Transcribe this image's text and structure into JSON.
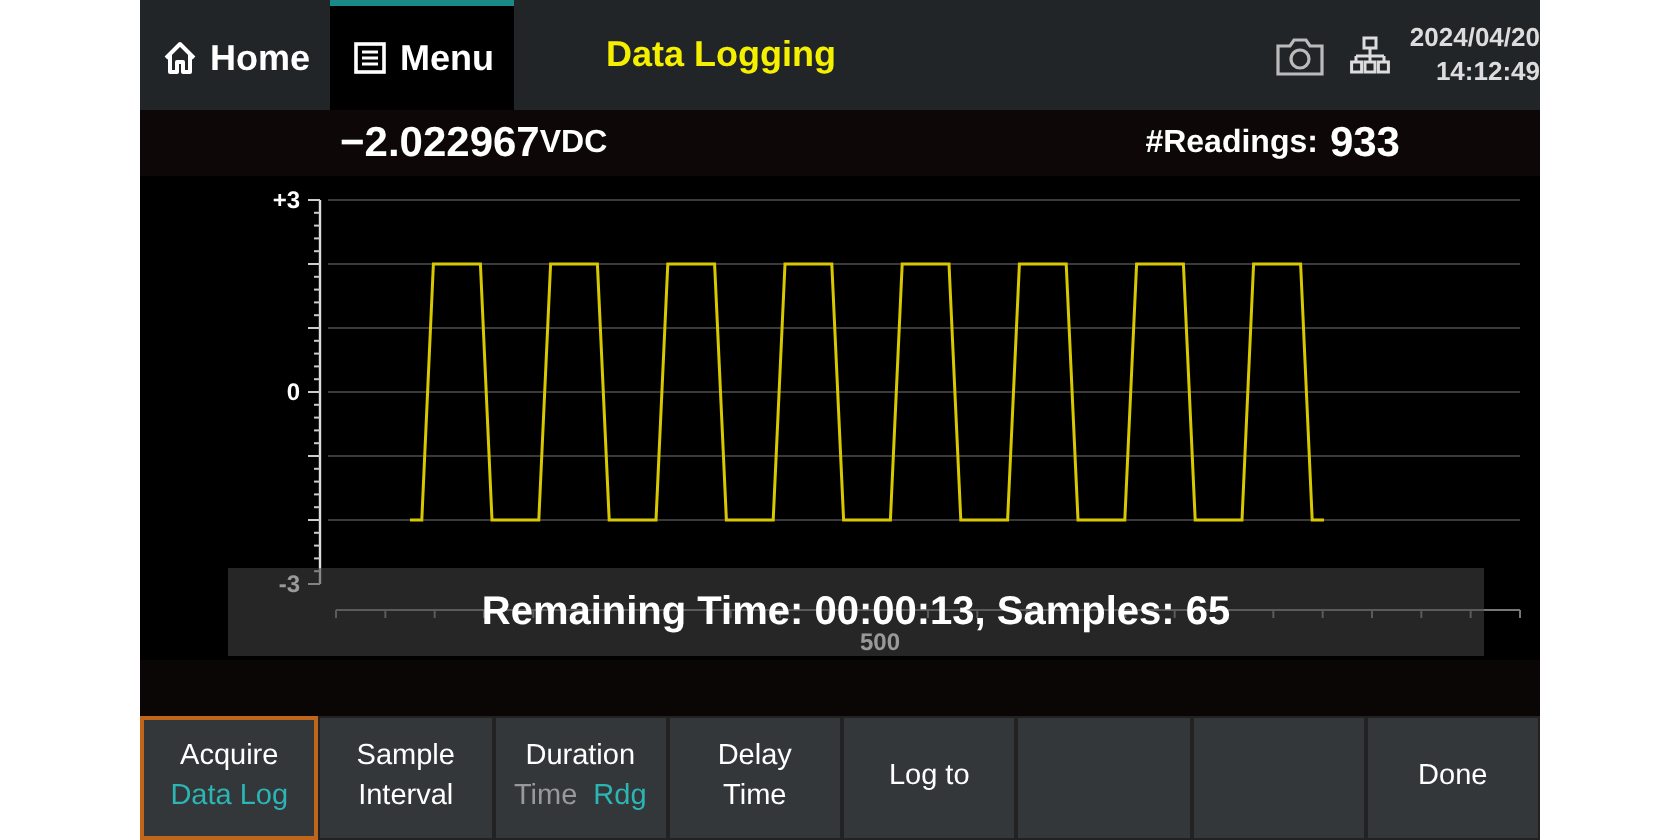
{
  "top_bar": {
    "tabs": [
      {
        "label": "Home",
        "selected": false
      },
      {
        "label": "Menu",
        "selected": true
      }
    ],
    "title": "Data Logging",
    "date": "2024/04/20",
    "time": "14:12:49"
  },
  "reading": {
    "value": "−2.022967",
    "unit": "VDC",
    "count_label": "#Readings:",
    "count": "933"
  },
  "chart_data": {
    "type": "line",
    "ylim": [
      -3,
      3
    ],
    "yticks": [
      {
        "value": 3,
        "label": "+3"
      },
      {
        "value": 0,
        "label": "0"
      },
      {
        "value": -3,
        "label": "-3"
      }
    ],
    "annotations": [
      "500"
    ],
    "series": [
      {
        "color": "#d8c800",
        "values": [
          -2,
          -2,
          2,
          2,
          2,
          2,
          2,
          -2,
          -2,
          -2,
          -2,
          -2,
          2,
          2,
          2,
          2,
          2,
          -2,
          -2,
          -2,
          -2,
          -2,
          2,
          2,
          2,
          2,
          2,
          -2,
          -2,
          -2,
          -2,
          -2,
          2,
          2,
          2,
          2,
          2,
          -2,
          -2,
          -2,
          -2,
          -2,
          2,
          2,
          2,
          2,
          2,
          -2,
          -2,
          -2,
          -2,
          -2,
          2,
          2,
          2,
          2,
          2,
          -2,
          -2,
          -2,
          -2,
          -2,
          2,
          2,
          2,
          2,
          2,
          -2,
          -2,
          -2,
          -2,
          -2,
          2,
          2,
          2,
          2,
          2,
          -2,
          -2
        ]
      }
    ]
  },
  "status": {
    "label": "Remaining Time:",
    "time": "00:00:13",
    "samples_label": ", Samples:",
    "samples": "65"
  },
  "softkeys": [
    {
      "kind": "option",
      "lines": [
        "Acquire"
      ],
      "options": [
        {
          "text": "Data Log",
          "active": true
        }
      ],
      "selected": true
    },
    {
      "kind": "plain",
      "lines": [
        "Sample",
        "Interval"
      ],
      "selected": false
    },
    {
      "kind": "option",
      "lines": [
        "Duration"
      ],
      "options": [
        {
          "text": "Time",
          "active": false
        },
        {
          "text": "Rdg",
          "active": true
        }
      ],
      "selected": false
    },
    {
      "kind": "plain",
      "lines": [
        "Delay",
        "Time"
      ],
      "selected": false
    },
    {
      "kind": "plain",
      "lines": [
        "Log to"
      ],
      "selected": false
    },
    {
      "kind": "blank",
      "selected": false
    },
    {
      "kind": "blank",
      "selected": false
    },
    {
      "kind": "plain",
      "lines": [
        "Done"
      ],
      "selected": false
    }
  ]
}
